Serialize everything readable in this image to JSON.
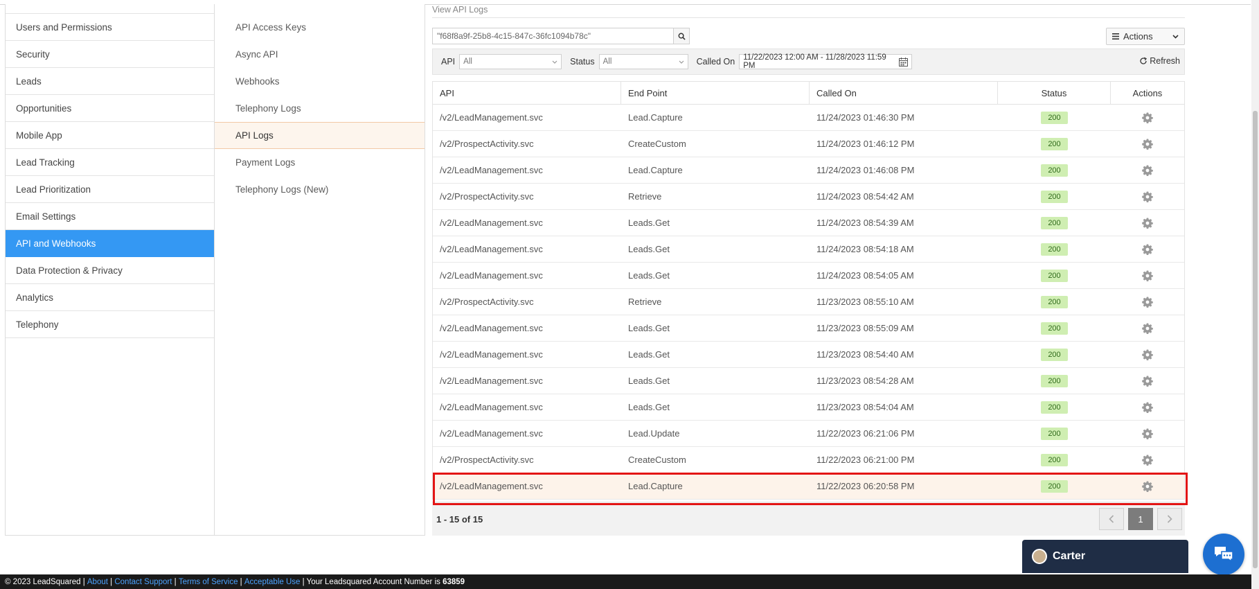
{
  "sidebar": {
    "items": [
      {
        "label": "Users and Permissions"
      },
      {
        "label": "Security"
      },
      {
        "label": "Leads"
      },
      {
        "label": "Opportunities"
      },
      {
        "label": "Mobile App"
      },
      {
        "label": "Lead Tracking"
      },
      {
        "label": "Lead Prioritization"
      },
      {
        "label": "Email Settings"
      },
      {
        "label": "API and Webhooks",
        "active": true
      },
      {
        "label": "Data Protection & Privacy"
      },
      {
        "label": "Analytics"
      },
      {
        "label": "Telephony"
      }
    ]
  },
  "subnav": {
    "items": [
      {
        "label": "API Access Keys"
      },
      {
        "label": "Async API"
      },
      {
        "label": "Webhooks"
      },
      {
        "label": "Telephony Logs"
      },
      {
        "label": "API Logs",
        "active": true
      },
      {
        "label": "Payment Logs"
      },
      {
        "label": "Telephony Logs (New)"
      }
    ]
  },
  "main": {
    "title": "View API Logs",
    "search_value": "\"f68f8a9f-25b8-4c15-847c-36fc1094b78c\"",
    "actions_label": "Actions",
    "filters": {
      "api_label": "API",
      "api_value": "All",
      "status_label": "Status",
      "status_value": "All",
      "called_on_label": "Called On",
      "called_on_value": "11/22/2023 12:00 AM - 11/28/2023 11:59 PM",
      "refresh_label": "Refresh"
    },
    "table": {
      "headers": [
        "API",
        "End Point",
        "Called On",
        "Status",
        "Actions"
      ],
      "rows": [
        {
          "api": "/v2/LeadManagement.svc",
          "endpoint": "Lead.Capture",
          "called_on": "11/24/2023 01:46:30 PM",
          "status": "200"
        },
        {
          "api": "/v2/ProspectActivity.svc",
          "endpoint": "CreateCustom",
          "called_on": "11/24/2023 01:46:12 PM",
          "status": "200"
        },
        {
          "api": "/v2/LeadManagement.svc",
          "endpoint": "Lead.Capture",
          "called_on": "11/24/2023 01:46:08 PM",
          "status": "200"
        },
        {
          "api": "/v2/ProspectActivity.svc",
          "endpoint": "Retrieve",
          "called_on": "11/24/2023 08:54:42 AM",
          "status": "200"
        },
        {
          "api": "/v2/LeadManagement.svc",
          "endpoint": "Leads.Get",
          "called_on": "11/24/2023 08:54:39 AM",
          "status": "200"
        },
        {
          "api": "/v2/LeadManagement.svc",
          "endpoint": "Leads.Get",
          "called_on": "11/24/2023 08:54:18 AM",
          "status": "200"
        },
        {
          "api": "/v2/LeadManagement.svc",
          "endpoint": "Leads.Get",
          "called_on": "11/24/2023 08:54:05 AM",
          "status": "200"
        },
        {
          "api": "/v2/ProspectActivity.svc",
          "endpoint": "Retrieve",
          "called_on": "11/23/2023 08:55:10 AM",
          "status": "200"
        },
        {
          "api": "/v2/LeadManagement.svc",
          "endpoint": "Leads.Get",
          "called_on": "11/23/2023 08:55:09 AM",
          "status": "200"
        },
        {
          "api": "/v2/LeadManagement.svc",
          "endpoint": "Leads.Get",
          "called_on": "11/23/2023 08:54:40 AM",
          "status": "200"
        },
        {
          "api": "/v2/LeadManagement.svc",
          "endpoint": "Leads.Get",
          "called_on": "11/23/2023 08:54:28 AM",
          "status": "200"
        },
        {
          "api": "/v2/LeadManagement.svc",
          "endpoint": "Leads.Get",
          "called_on": "11/23/2023 08:54:04 AM",
          "status": "200"
        },
        {
          "api": "/v2/LeadManagement.svc",
          "endpoint": "Lead.Update",
          "called_on": "11/22/2023 06:21:06 PM",
          "status": "200"
        },
        {
          "api": "/v2/ProspectActivity.svc",
          "endpoint": "CreateCustom",
          "called_on": "11/22/2023 06:21:00 PM",
          "status": "200"
        },
        {
          "api": "/v2/LeadManagement.svc",
          "endpoint": "Lead.Capture",
          "called_on": "11/22/2023 06:20:58 PM",
          "status": "200",
          "highlight": true
        }
      ]
    },
    "pagination": {
      "summary": "1 - 15 of 15",
      "current_page": "1"
    }
  },
  "chat": {
    "agent_name": "Carter"
  },
  "footer": {
    "copyright": "© 2023 LeadSquared | ",
    "about": "About",
    "contact": "Contact Support",
    "terms": "Terms of Service",
    "acceptable": "Acceptable Use",
    "account_text": " | Your Leadsquared Account Number is ",
    "account_number": "63859"
  },
  "colors": {
    "accent": "#3498f3",
    "status_badge_bg": "#cfeeb2",
    "highlight_border": "#e31414",
    "chat_bar": "#1f2d45",
    "chat_fab": "#1d6fd1"
  }
}
